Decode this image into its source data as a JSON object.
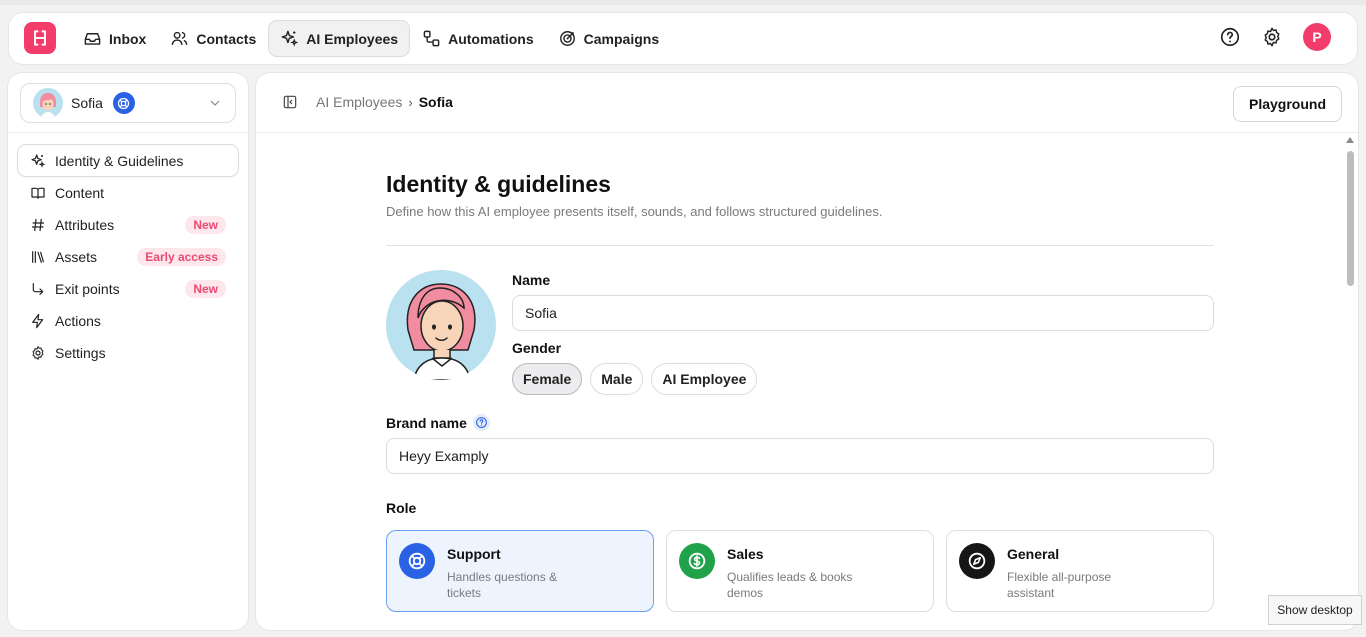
{
  "nav": {
    "items": [
      {
        "label": "Inbox",
        "icon": "inbox-icon"
      },
      {
        "label": "Contacts",
        "icon": "contacts-icon"
      },
      {
        "label": "AI Employees",
        "icon": "sparkles-icon",
        "active": true
      },
      {
        "label": "Automations",
        "icon": "automations-icon"
      },
      {
        "label": "Campaigns",
        "icon": "campaigns-icon"
      }
    ],
    "user_initial": "P"
  },
  "sidebar": {
    "employee_name": "Sofia",
    "items": [
      {
        "label": "Identity & Guidelines",
        "icon": "sparkles-icon",
        "active": true,
        "badge": ""
      },
      {
        "label": "Content",
        "icon": "book-icon",
        "badge": ""
      },
      {
        "label": "Attributes",
        "icon": "hash-icon",
        "badge": "New"
      },
      {
        "label": "Assets",
        "icon": "library-icon",
        "badge": "Early access"
      },
      {
        "label": "Exit points",
        "icon": "corner-down-right-icon",
        "badge": "New"
      },
      {
        "label": "Actions",
        "icon": "zap-icon",
        "badge": ""
      },
      {
        "label": "Settings",
        "icon": "gear-icon",
        "badge": ""
      }
    ]
  },
  "breadcrumb": {
    "parent": "AI Employees",
    "current": "Sofia"
  },
  "header": {
    "playground_label": "Playground"
  },
  "page": {
    "title": "Identity & guidelines",
    "subtitle": "Define how this AI employee presents itself, sounds, and follows structured guidelines."
  },
  "form": {
    "name_label": "Name",
    "name_value": "Sofia",
    "gender_label": "Gender",
    "gender_options": [
      "Female",
      "Male",
      "AI Employee"
    ],
    "gender_selected": "Female",
    "brand_label": "Brand name",
    "brand_value": "Heyy Examply",
    "role_label": "Role",
    "roles": [
      {
        "title": "Support",
        "desc": "Handles questions & tickets",
        "color": "#2a62e6",
        "selected": true
      },
      {
        "title": "Sales",
        "desc": "Qualifies leads & books demos",
        "color": "#1fa24a"
      },
      {
        "title": "General",
        "desc": "Flexible all-purpose assistant",
        "color": "#161616"
      }
    ]
  },
  "taskbar": {
    "show_desktop": "Show desktop"
  },
  "colors": {
    "brand": "#f23d6b",
    "accent": "#2a62e6"
  }
}
